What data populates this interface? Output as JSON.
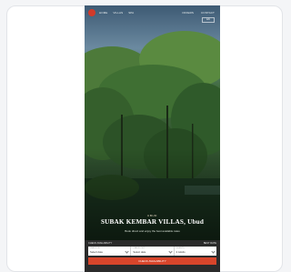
{
  "header": {
    "nav_items": [
      "HOME",
      "VILLAS",
      "SPA"
    ],
    "nav_right": [
      "OFFERS",
      "CONTACT"
    ],
    "language": "EN"
  },
  "hero": {
    "eyebrow": "UBUD",
    "title": "SUBAK KEMBAR VILLAS, Ubud",
    "subtitle": "Book direct and enjoy the best available rates"
  },
  "booking": {
    "heading_left": "CHECK AVAILABILITY",
    "heading_right": "BEST RATE",
    "fields": [
      {
        "label": "CHECK IN",
        "value": "Select date"
      },
      {
        "label": "CHECK OUT",
        "value": "Select date"
      },
      {
        "label": "GUESTS",
        "value": "2 Adults"
      }
    ],
    "search_label": "CHECK AVAILABILITY"
  },
  "colors": {
    "accent": "#d8452b",
    "logo": "#d23a2a",
    "panel": "#2b2b2b"
  }
}
